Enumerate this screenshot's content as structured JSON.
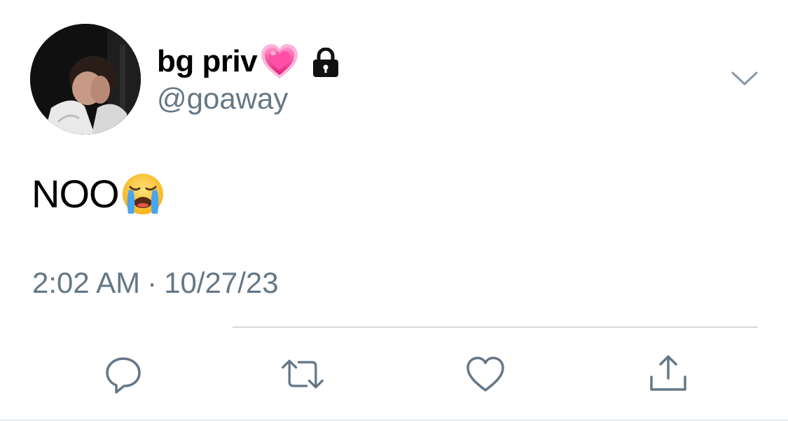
{
  "tweet": {
    "display_name": "bg priv",
    "handle": "@goaway",
    "text": "NOO",
    "time": "2:02 AM",
    "separator": "·",
    "date": "10/27/23",
    "account_locked": true
  },
  "icons": {
    "avatar": "profile-photo",
    "name_emoji": "growing-heart-emoji",
    "lock": "lock-icon",
    "text_emoji": "loudly-crying-face-emoji",
    "menu": "chevron-down-icon",
    "reply": "reply-icon",
    "retweet": "retweet-icon",
    "like": "heart-icon",
    "share": "share-icon"
  },
  "colors": {
    "text_primary": "#000000",
    "text_secondary": "#657786",
    "icon": "#657786",
    "divider": "#d4d9de"
  }
}
